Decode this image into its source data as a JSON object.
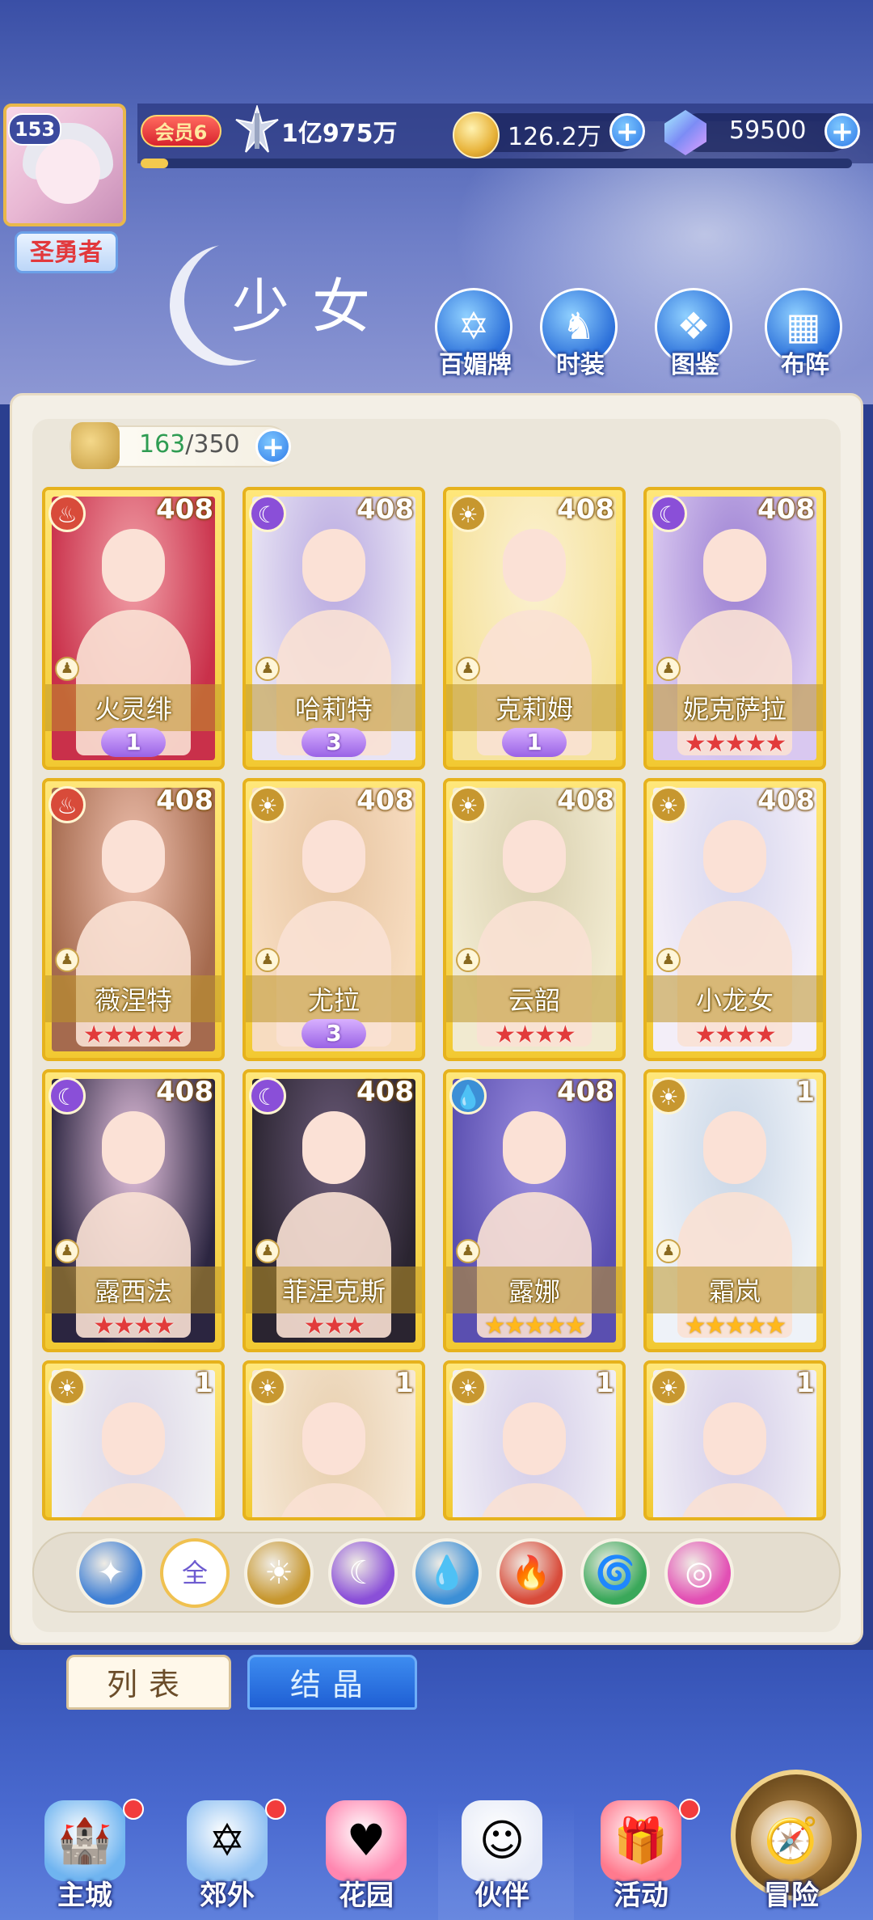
{
  "player": {
    "level": "153",
    "title": "圣勇者",
    "vip": "会员6",
    "power": "1亿975万",
    "gold": "126.2万",
    "gems": "59500"
  },
  "section": {
    "title": "少女"
  },
  "menu": [
    {
      "label": "百媚牌",
      "icon": "hexagram-card-icon"
    },
    {
      "label": "时装",
      "icon": "outfit-icon"
    },
    {
      "label": "图鉴",
      "icon": "book-icon"
    },
    {
      "label": "布阵",
      "icon": "grid-formation-icon"
    }
  ],
  "roster": {
    "current": "163",
    "total": "/350"
  },
  "cards": [
    {
      "name": "火灵绯",
      "level": "408",
      "element": "fire",
      "stars": 0,
      "badge": "1"
    },
    {
      "name": "哈莉特",
      "level": "408",
      "element": "dark",
      "stars": 0,
      "badge": "3"
    },
    {
      "name": "克莉姆",
      "level": "408",
      "element": "light",
      "stars": 0,
      "badge": "1"
    },
    {
      "name": "妮克萨拉",
      "level": "408",
      "element": "dark",
      "stars": 5,
      "star_color": "red"
    },
    {
      "name": "薇涅特",
      "level": "408",
      "element": "fire",
      "stars": 5,
      "star_color": "red"
    },
    {
      "name": "尤拉",
      "level": "408",
      "element": "light",
      "stars": 0,
      "badge": "3"
    },
    {
      "name": "云韶",
      "level": "408",
      "element": "light",
      "stars": 4,
      "star_color": "red"
    },
    {
      "name": "小龙女",
      "level": "408",
      "element": "light",
      "stars": 4,
      "star_color": "red"
    },
    {
      "name": "露西法",
      "level": "408",
      "element": "dark",
      "stars": 4,
      "star_color": "red"
    },
    {
      "name": "菲涅克斯",
      "level": "408",
      "element": "dark",
      "stars": 3,
      "star_color": "red"
    },
    {
      "name": "露娜",
      "level": "408",
      "element": "water",
      "stars": 5,
      "star_color": "gold"
    },
    {
      "name": "霜岚",
      "level": "1",
      "element": "light",
      "stars": 5,
      "star_color": "gold"
    },
    {
      "name": "",
      "level": "1",
      "element": "light",
      "stars": 0
    },
    {
      "name": "",
      "level": "1",
      "element": "light",
      "stars": 0
    },
    {
      "name": "",
      "level": "1",
      "element": "light",
      "stars": 0
    },
    {
      "name": "",
      "level": "1",
      "element": "light",
      "stars": 0
    }
  ],
  "filters": [
    {
      "name": "filter-wing",
      "label": "",
      "icon": "✦",
      "color": "#3f7fd4"
    },
    {
      "name": "filter-all",
      "label": "全",
      "icon": "",
      "color": "#ffffff",
      "selected": true
    },
    {
      "name": "filter-light",
      "label": "",
      "icon": "☀",
      "color": "#c7972f"
    },
    {
      "name": "filter-dark",
      "label": "",
      "icon": "☾",
      "color": "#8a4fd8"
    },
    {
      "name": "filter-water",
      "label": "",
      "icon": "💧",
      "color": "#3c8fd6"
    },
    {
      "name": "filter-fire",
      "label": "",
      "icon": "🔥",
      "color": "#d84b3a"
    },
    {
      "name": "filter-wind",
      "label": "",
      "icon": "🌀",
      "color": "#3aa85a"
    },
    {
      "name": "filter-spirit",
      "label": "",
      "icon": "◎",
      "color": "#e24fb4"
    }
  ],
  "tabs": {
    "list": "列表",
    "crystal": "结晶"
  },
  "nav": [
    {
      "label": "主城",
      "icon": "castle-icon",
      "dot": true
    },
    {
      "label": "郊外",
      "icon": "portal-icon",
      "dot": true
    },
    {
      "label": "花园",
      "icon": "heart-icon",
      "dot": false
    },
    {
      "label": "伙伴",
      "icon": "partner-icon",
      "dot": false,
      "active": true
    },
    {
      "label": "活动",
      "icon": "gift-icon",
      "dot": true
    },
    {
      "label": "冒险",
      "icon": "compass-icon",
      "dot": false
    }
  ],
  "colors": {
    "accent": "#2f7ae8",
    "card_gold": "#f2c932",
    "panel": "#f3efe6"
  }
}
